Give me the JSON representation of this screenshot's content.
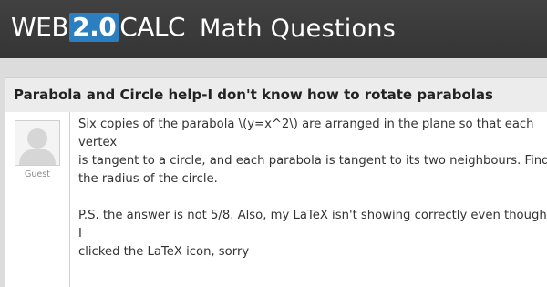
{
  "header": {
    "logo": {
      "part1": "WEB",
      "part2": "2.0",
      "part3": "CALC"
    },
    "site_title": "Math Questions",
    "background_color": "#3a3a3a",
    "badge_color": "#2b7fc0"
  },
  "question": {
    "title": "Parabola and Circle help-I don't know how to rotate parabolas"
  },
  "post": {
    "author": "Guest",
    "avatar_icon": "user-avatar-icon",
    "paragraph1": "Six copies of the parabola \\(y=x^2\\) are arranged in the plane so that each vertex\nis tangent to a circle, and each parabola is tangent to its two neighbours. Find\nthe radius of the circle.",
    "paragraph2": "P.S. the answer is not 5/8. Also, my LaTeX isn't showing correctly even though I\nclicked the LaTeX icon, sorry"
  }
}
